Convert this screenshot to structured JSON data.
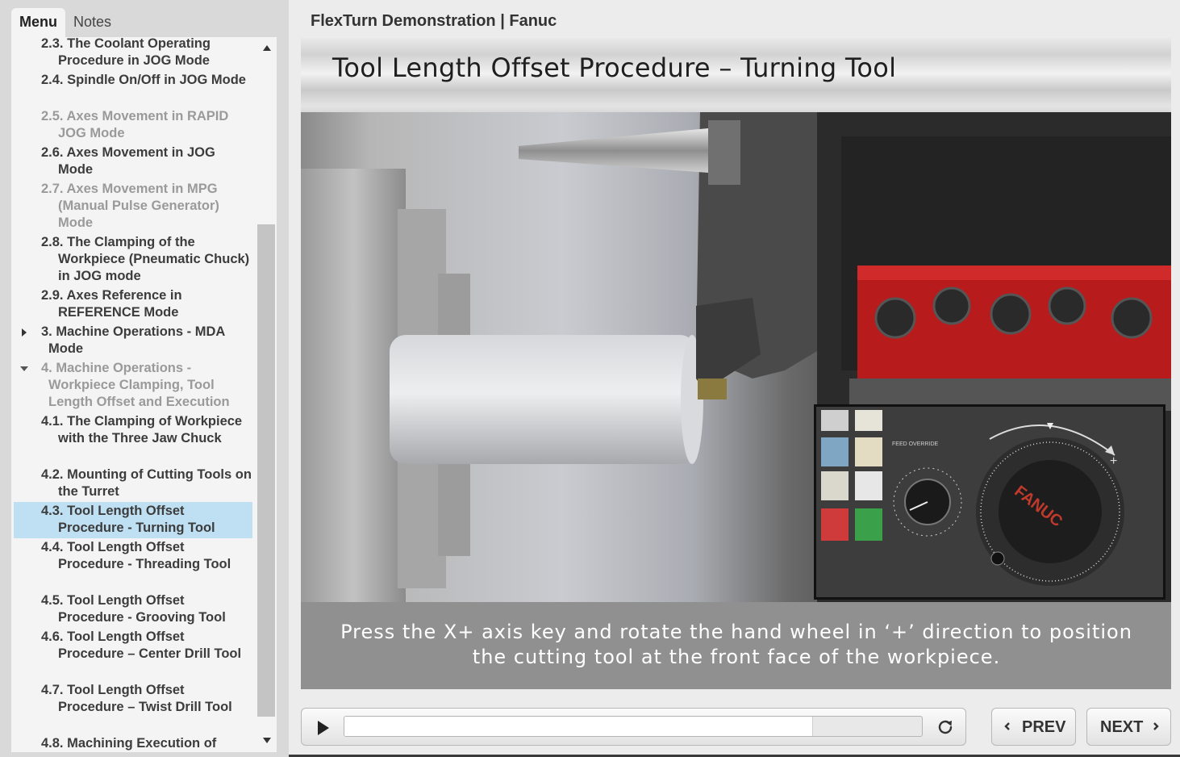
{
  "tabs": {
    "menu": "Menu",
    "notes": "Notes"
  },
  "menu_items": [
    {
      "num": "2.3.",
      "text": "The Coolant Operating Procedure in JOG Mode",
      "dim": false
    },
    {
      "num": "2.4.",
      "text": "Spindle On/Off in JOG Mode",
      "dim": false
    },
    {
      "num": "2.5.",
      "text": "Axes Movement in RAPID JOG Mode",
      "dim": true
    },
    {
      "num": "2.6.",
      "text": "Axes Movement in JOG Mode",
      "dim": false
    },
    {
      "num": "2.7.",
      "text": "Axes Movement in MPG (Manual Pulse Generator) Mode",
      "dim": true
    },
    {
      "num": "2.8.",
      "text": "The Clamping of the Workpiece (Pneumatic Chuck) in JOG mode",
      "dim": false
    },
    {
      "num": "2.9.",
      "text": "Axes Reference in REFERENCE Mode",
      "dim": false
    },
    {
      "num": "3.",
      "text": "Machine Operations - MDA Mode",
      "dim": false
    },
    {
      "num": "4.",
      "text": "Machine Operations - Workpiece Clamping, Tool Length Offset and Execution",
      "dim": true
    },
    {
      "num": "4.1.",
      "text": "The Clamping of Workpiece with the Three Jaw Chuck",
      "dim": false
    },
    {
      "num": "4.2.",
      "text": "Mounting of Cutting Tools on the Turret",
      "dim": false
    },
    {
      "num": "4.3.",
      "text": "Tool Length Offset Procedure - Turning Tool",
      "dim": false
    },
    {
      "num": "4.4.",
      "text": "Tool Length Offset Procedure - Threading Tool",
      "dim": false
    },
    {
      "num": "4.5.",
      "text": "Tool Length Offset Procedure - Grooving Tool",
      "dim": false
    },
    {
      "num": "4.6.",
      "text": "Tool Length Offset Procedure – Center Drill Tool",
      "dim": false
    },
    {
      "num": "4.7.",
      "text": "Tool Length Offset Procedure – Twist Drill Tool",
      "dim": false
    },
    {
      "num": "4.8.",
      "text": "Machining Execution of",
      "dim": false
    }
  ],
  "selected_item": "4.3.",
  "course_title": "FlexTurn Demonstration | Fanuc",
  "slide_title": "Tool Length Offset Procedure – Turning Tool",
  "caption_line1": "Press the X+ axis key and rotate the hand wheel in ‘+’ direction to position",
  "caption_line2": "the cutting tool at the front face of the workpiece.",
  "inset_labels": {
    "feed_override": "FEED OVERRIDE",
    "brand": "FANUC"
  },
  "player": {
    "progress": 0.81
  },
  "nav": {
    "prev": "PREV",
    "next": "NEXT"
  }
}
